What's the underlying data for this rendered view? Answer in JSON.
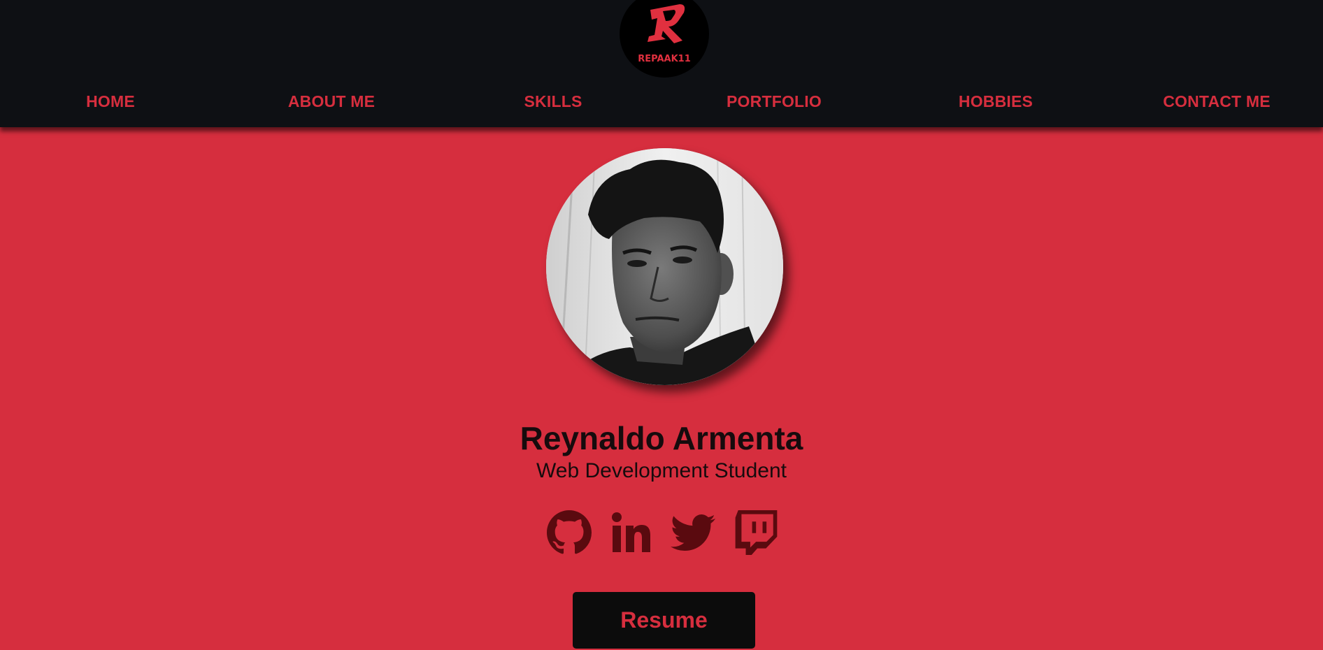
{
  "brand": {
    "logo_text": "REPAAK11",
    "logo_letter": "R"
  },
  "nav": {
    "items": [
      {
        "label": "HOME"
      },
      {
        "label": "ABOUT ME"
      },
      {
        "label": "SKILLS"
      },
      {
        "label": "PORTFOLIO"
      },
      {
        "label": "HOBBIES"
      },
      {
        "label": "CONTACT ME"
      }
    ]
  },
  "profile": {
    "name": "Reynaldo Armenta",
    "title": "Web Development Student"
  },
  "social": {
    "icons": [
      "github-icon",
      "linkedin-icon",
      "twitter-icon",
      "twitch-icon"
    ]
  },
  "resume": {
    "label": "Resume"
  },
  "colors": {
    "background": "#d62e3e",
    "nav_background": "#0e1014",
    "accent": "#d62e3e",
    "icon_color": "#5a0a0f",
    "text_dark": "#160b0d"
  }
}
